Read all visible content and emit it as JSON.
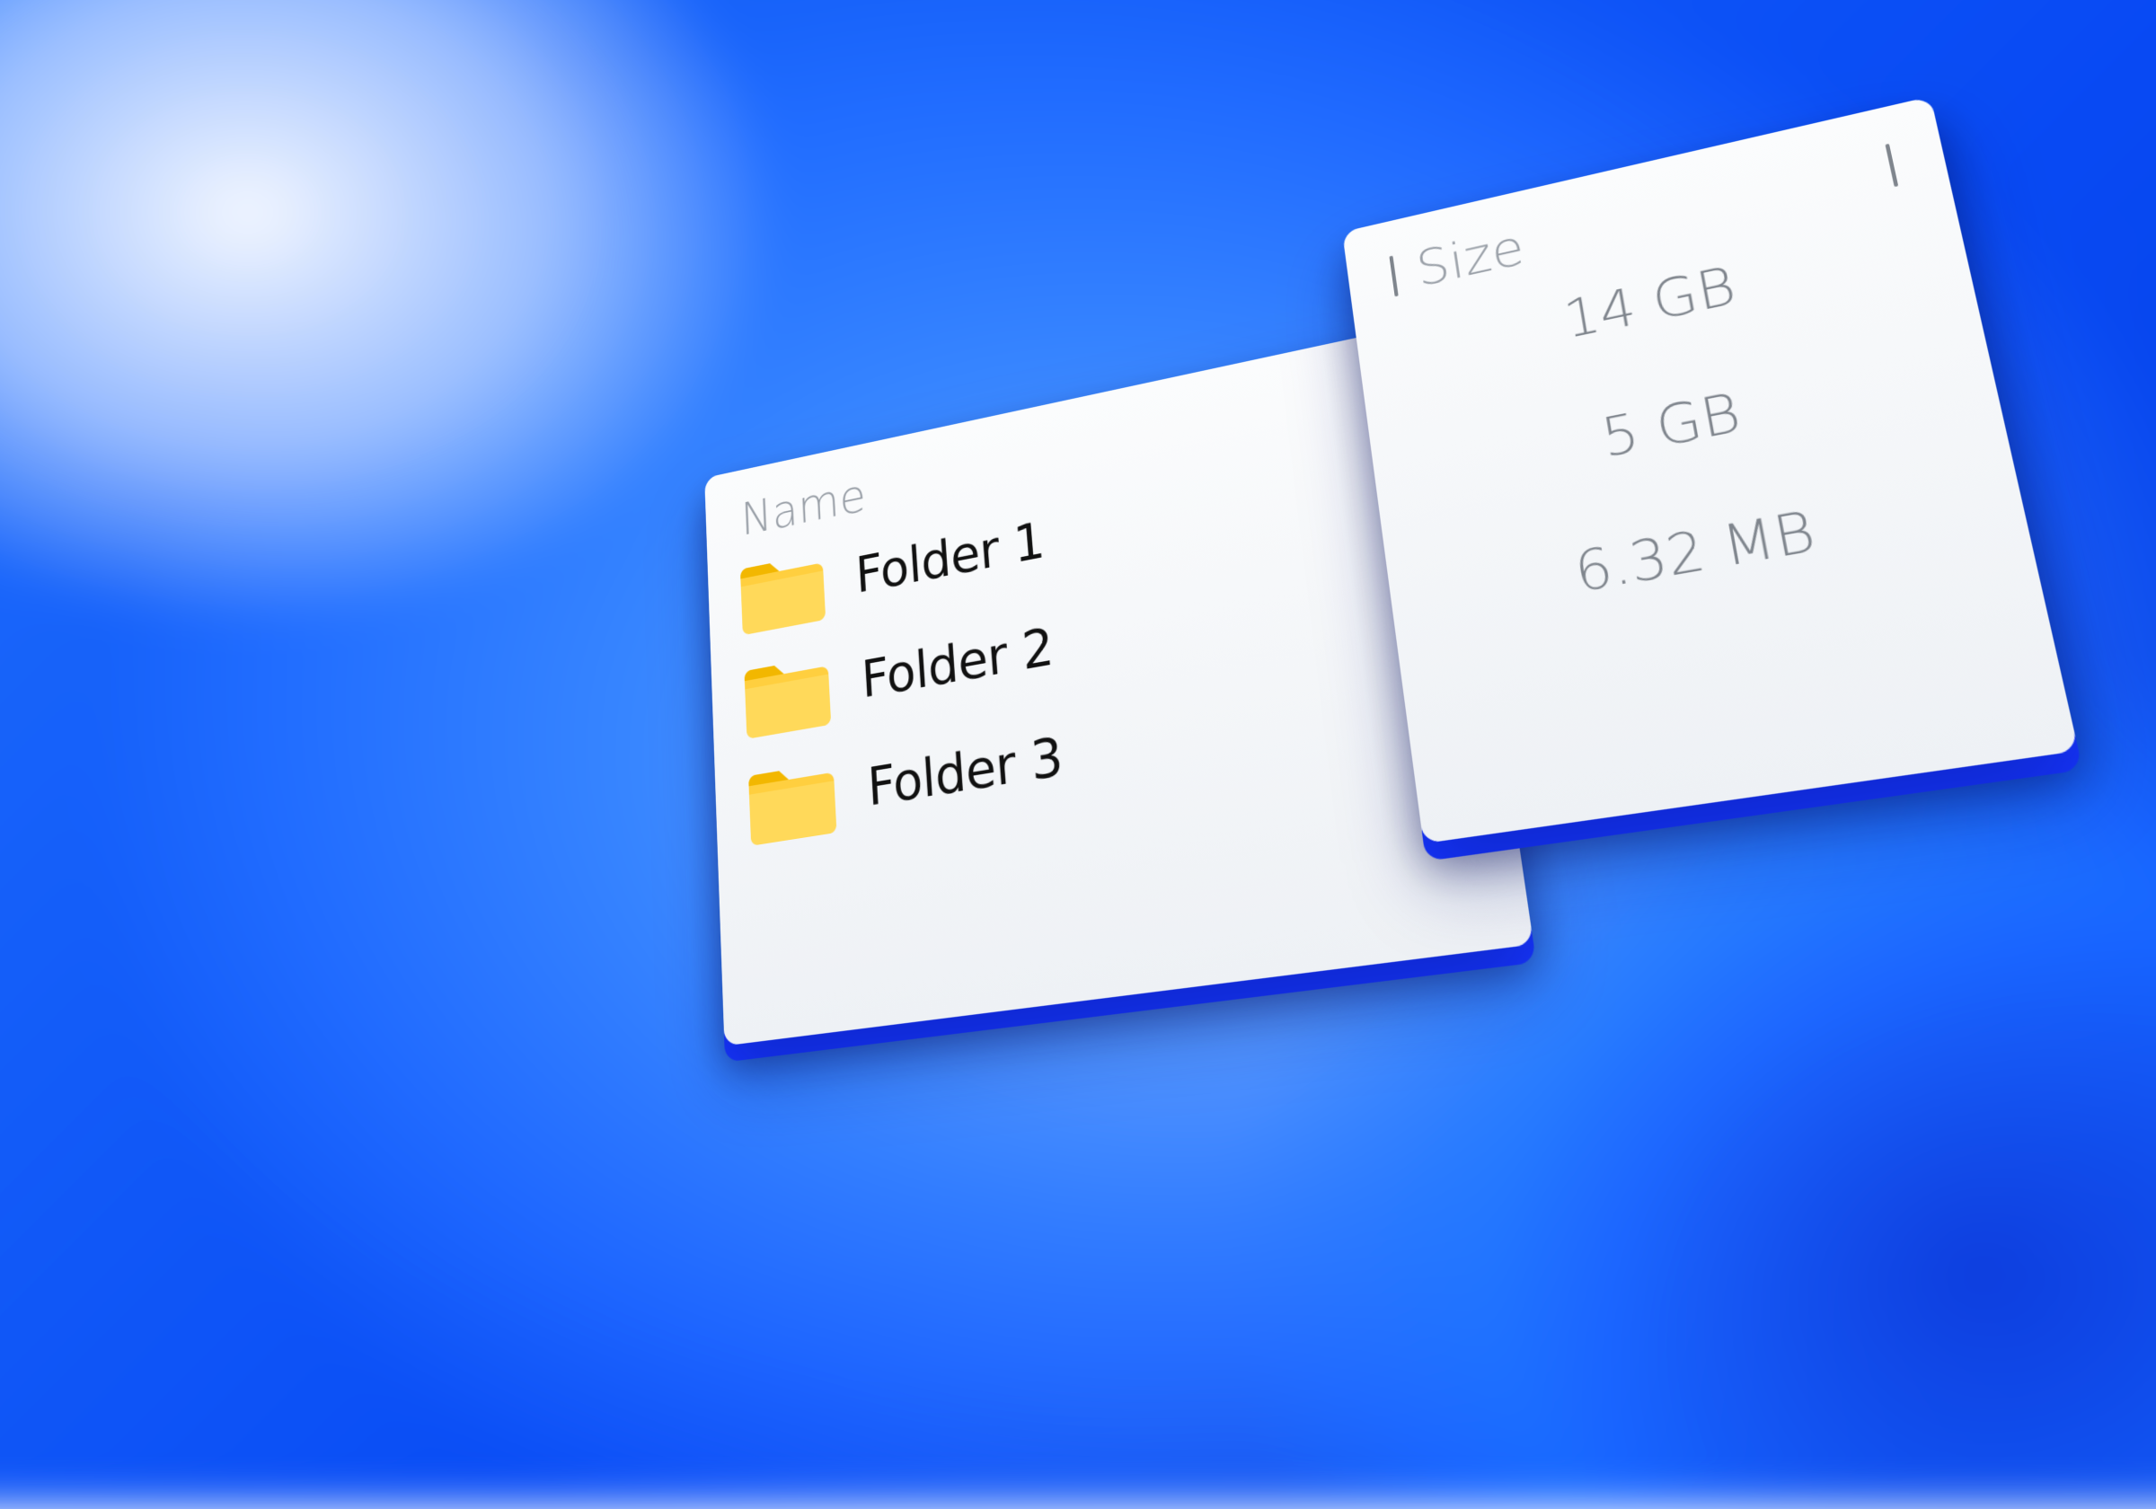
{
  "columns": {
    "name_header": "Name",
    "size_header": "Size"
  },
  "folders": [
    {
      "name": "Folder 1",
      "size": "14 GB"
    },
    {
      "name": "Folder 2",
      "size": "5 GB"
    },
    {
      "name": "Folder 3",
      "size": "6.32 MB"
    }
  ],
  "icons": {
    "folder": "folder-icon"
  },
  "colors": {
    "accent_edge": "#1735ff",
    "folder_fill": "#ffcf3f",
    "folder_tab": "#f2b700"
  }
}
